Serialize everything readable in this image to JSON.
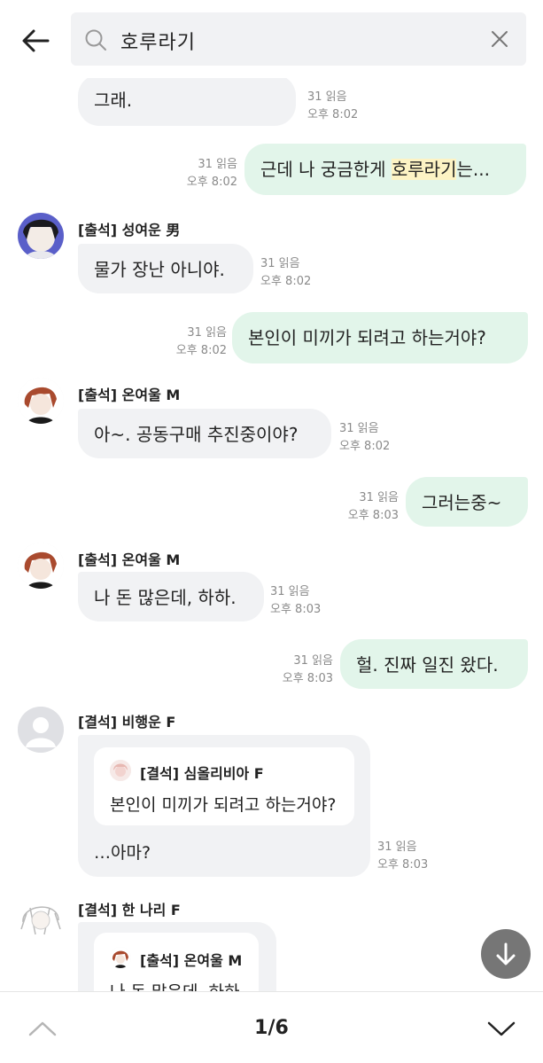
{
  "search": {
    "query": "호루라기"
  },
  "messages": {
    "m0": {
      "text": "그래.",
      "read": "31 읽음",
      "time": "오후 8:02"
    },
    "m1": {
      "text_before": "근데 나 궁금한게 ",
      "text_highlight": "호루라기",
      "text_after": "는...",
      "read": "31 읽음",
      "time": "오후 8:02"
    },
    "m2": {
      "sender": "[출석] 성여운 男",
      "text": "물가 장난 아니야.",
      "read": "31 읽음",
      "time": "오후 8:02"
    },
    "m3": {
      "text": "본인이 미끼가 되려고 하는거야?",
      "read": "31 읽음",
      "time": "오후 8:02"
    },
    "m4": {
      "sender": "[출석] 온여울 M",
      "text": "아~. 공동구매 추진중이야?",
      "read": "31 읽음",
      "time": "오후 8:02"
    },
    "m5": {
      "text": "그러는중~",
      "read": "31 읽음",
      "time": "오후 8:03"
    },
    "m6": {
      "sender": "[출석] 온여울 M",
      "text": "나 돈 많은데, 하하.",
      "read": "31 읽음",
      "time": "오후 8:03"
    },
    "m7": {
      "text": "헐. 진짜 일진 왔다.",
      "read": "31 읽음",
      "time": "오후 8:03"
    },
    "m8": {
      "sender": "[결석] 비행운 F",
      "quote_sender": "[결석] 심올리비아 F",
      "quote_text": "본인이 미끼가 되려고 하는거야?",
      "text": "…아마?",
      "read": "31 읽음",
      "time": "오후 8:03"
    },
    "m9": {
      "sender": "[결석] 한 나리 F",
      "quote_sender": "[출석] 온여울 M",
      "quote_text": "나 돈 많은데, 하하."
    }
  },
  "pager": {
    "label": "1/6"
  },
  "icons": {
    "back": "arrow-left-icon",
    "search": "search-icon",
    "clear": "close-icon",
    "scroll": "arrow-down-icon",
    "prev": "chevron-up-icon",
    "next": "chevron-down-icon"
  },
  "colors": {
    "incoming_bubble": "#f1f2f4",
    "outgoing_bubble": "#e2f5ea",
    "highlight": "#fdf3c4",
    "meta_text": "#8a8a8a"
  }
}
